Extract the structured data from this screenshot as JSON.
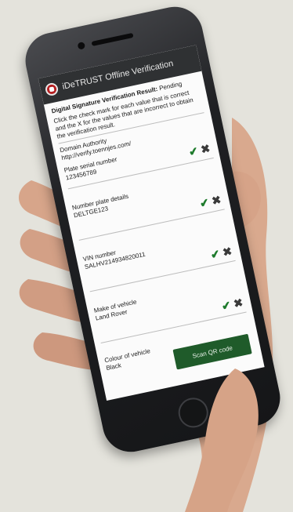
{
  "app": {
    "title": "iDeTRUST Offline Verification"
  },
  "status": {
    "label": "Digital Signature Verification Result:",
    "value": "Pending"
  },
  "instructions": "Click the check mark for each value that is correct and the X for the values that are incorrect to obtain the verification result.",
  "domain": {
    "label": "Domain Authority",
    "value": "http://verify.toennjes.com/"
  },
  "fields": [
    {
      "label": "Plate serial number",
      "value": "123456789"
    },
    {
      "label": "Number plate details",
      "value": "DELTGE123"
    },
    {
      "label": "VIN number",
      "value": "SALHV214934820011"
    },
    {
      "label": "Make of vehicle",
      "value": "Land Rover"
    },
    {
      "label": "Colour of vehicle",
      "value": "Black"
    }
  ],
  "icons": {
    "check": "✔",
    "cross": "✖"
  },
  "scan_button": {
    "label": "Scan QR code"
  },
  "colors": {
    "appbar": "#2f3133",
    "check": "#1e7b2c",
    "button": "#1f5b2a",
    "logo": "#b41e20"
  }
}
